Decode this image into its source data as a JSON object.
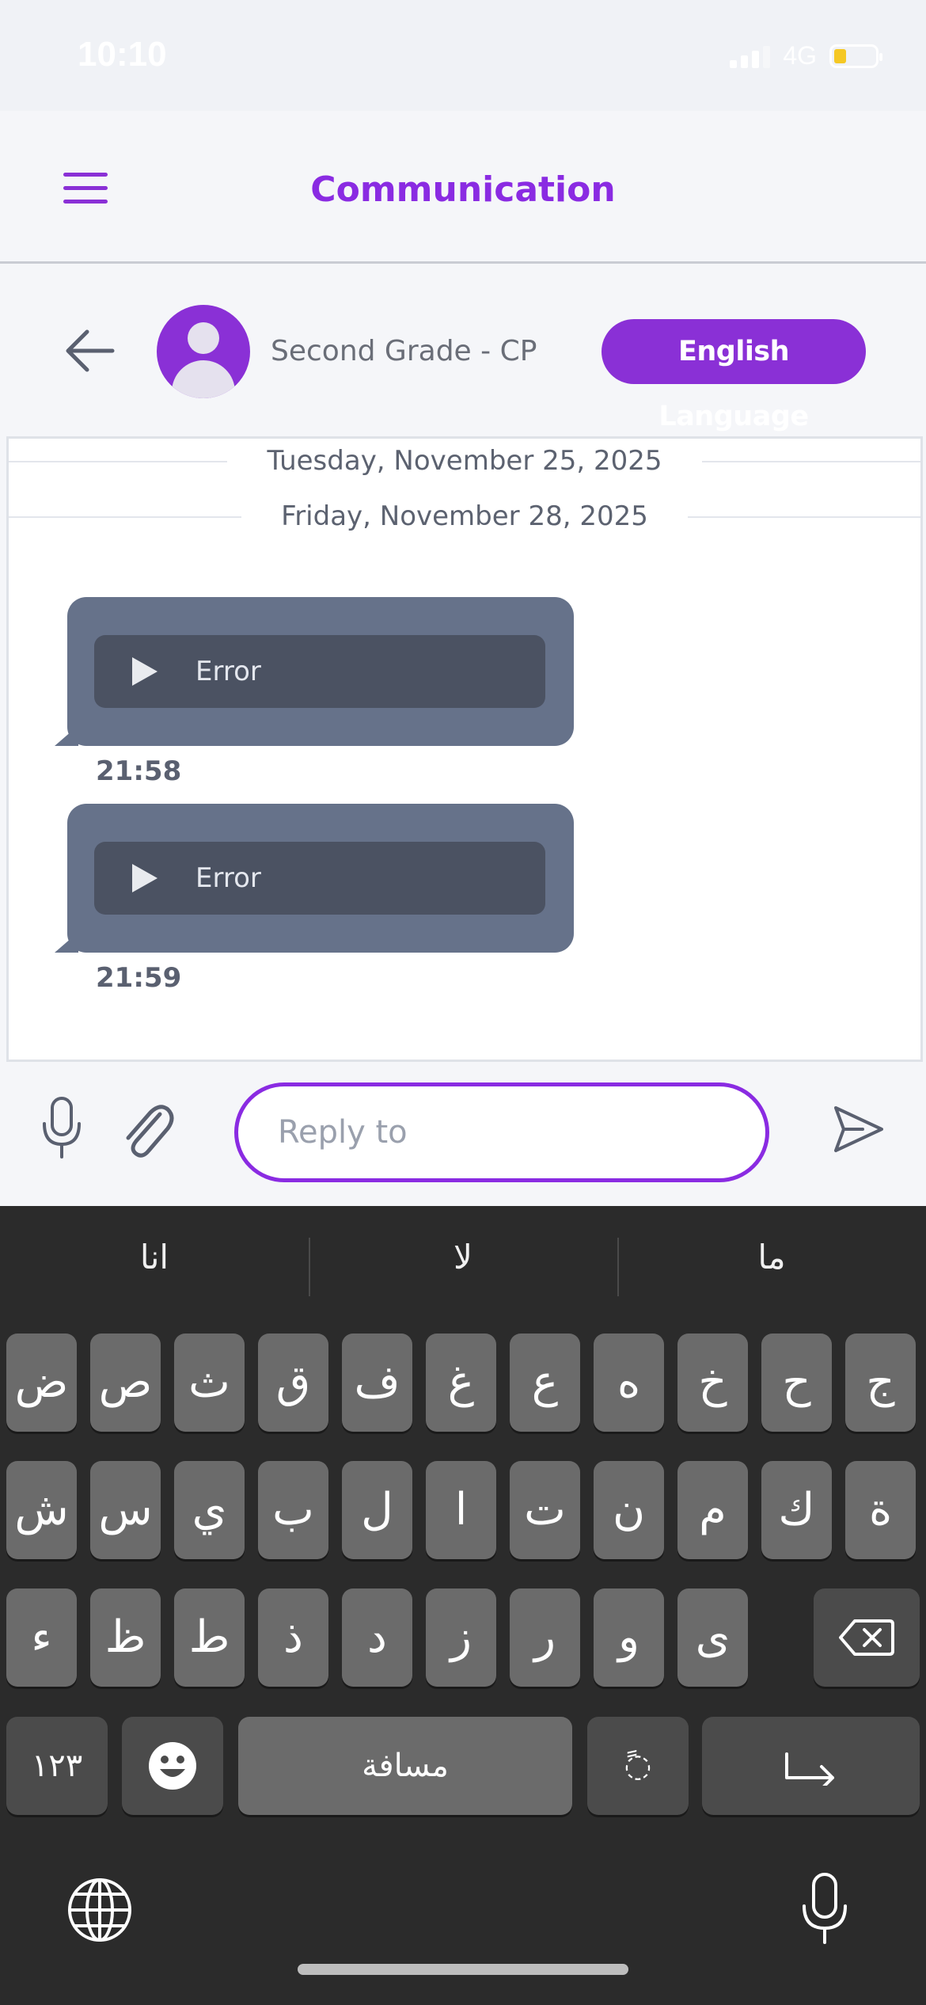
{
  "status_bar": {
    "time": "10:10",
    "network": "4G"
  },
  "header": {
    "title": "Communication"
  },
  "chat": {
    "group_name": "Second Grade - CP",
    "subject_badge": "English Language"
  },
  "messages": {
    "date_separators": [
      "Tuesday, November 25, 2025",
      "Friday, November 28, 2025"
    ],
    "items": [
      {
        "audio_label": "Error",
        "time": "21:58"
      },
      {
        "audio_label": "Error",
        "time": "21:59"
      }
    ]
  },
  "input": {
    "placeholder": "Reply to"
  },
  "keyboard": {
    "suggestions": [
      "انا",
      "لا",
      "ما"
    ],
    "row1": [
      "ض",
      "ص",
      "ث",
      "ق",
      "ف",
      "غ",
      "ع",
      "ه",
      "خ",
      "ح",
      "ج"
    ],
    "row2": [
      "ش",
      "س",
      "ي",
      "ب",
      "ل",
      "ا",
      "ت",
      "ن",
      "م",
      "ك",
      "ة"
    ],
    "row3": [
      "ء",
      "ظ",
      "ط",
      "ذ",
      "د",
      "ز",
      "ر",
      "و",
      "ى"
    ],
    "numbers_key": "١٢٣",
    "space_label": "مسافة",
    "diacritic_key": "◌ً"
  },
  "colors": {
    "accent": "#8a2be2",
    "bubble": "#66728a",
    "keyboard_bg": "#2b2b2b"
  }
}
